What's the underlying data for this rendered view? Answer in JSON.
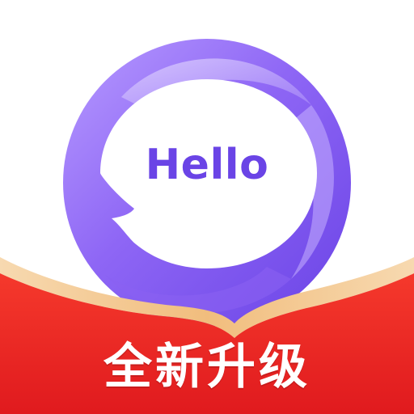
{
  "logo": {
    "bubble_text": "Hello",
    "colors": {
      "ring_light": "#c9b3ff",
      "ring_mid": "#9a72f7",
      "ring_dark": "#6e47e8",
      "text": "#6a44e6"
    }
  },
  "banner": {
    "label": "全新升级",
    "colors": {
      "red": "#f02a24",
      "red_dark": "#e31b1f",
      "gold_edge": "#f4c98f"
    }
  }
}
